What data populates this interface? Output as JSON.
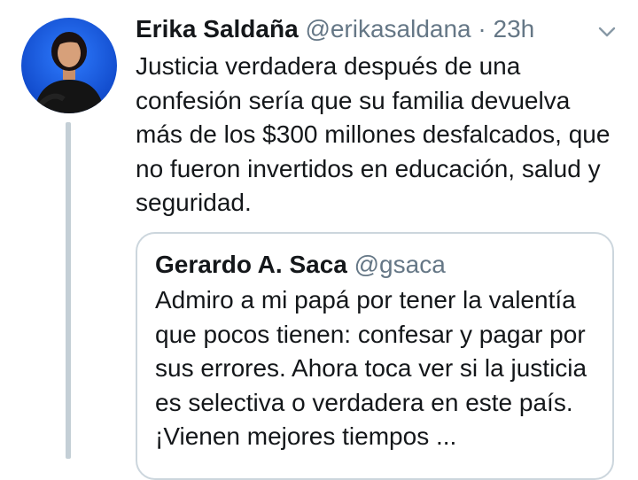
{
  "tweet": {
    "author_name": "Erika Saldaña",
    "author_handle": "@erikasaldana",
    "separator": "·",
    "time": "23h",
    "text": "Justicia verdadera después de una confesión sería que su familia devuelva más de los $300 millones desfalcados, que no fueron invertidos en educación, salud y seguridad.",
    "avatar_icon": "profile-photo",
    "menu_icon": "chevron-down-icon"
  },
  "quoted_tweet": {
    "author_name": "Gerardo A. Saca",
    "author_handle": "@gsaca",
    "text": "Admiro a mi papá por tener la valentía que pocos tienen: confesar y pagar por sus errores. Ahora toca ver si la justicia es selectiva o verdadera en este país. ¡Vienen mejores tiempos ..."
  },
  "colors": {
    "text_primary": "#14171a",
    "text_secondary": "#657786",
    "thread_line": "#c4cfd6",
    "card_border": "#ccd6dd",
    "avatar_background": "#0a4fd6"
  }
}
